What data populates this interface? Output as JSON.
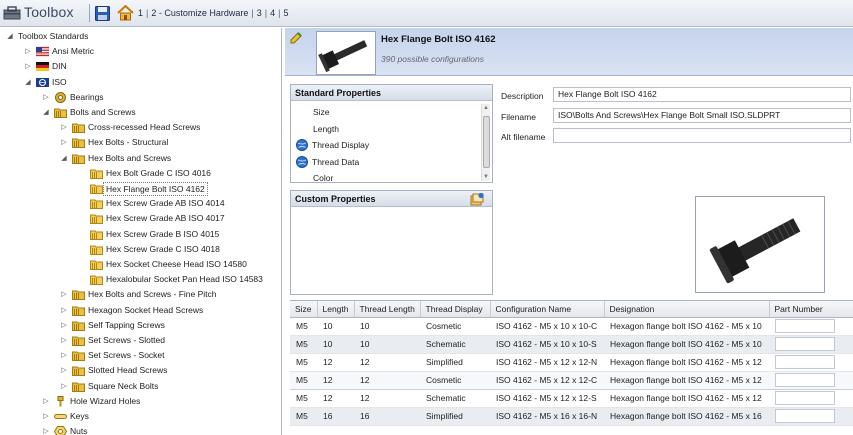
{
  "toolbar": {
    "title": "Toolbox",
    "breadcrumb": [
      "1",
      "2 - Customize Hardware",
      "3",
      "4",
      "5"
    ]
  },
  "tree": [
    {
      "label": "Toolbox Standards",
      "depth": 0,
      "twisty": "open",
      "icon": "none"
    },
    {
      "label": "Ansi Metric",
      "depth": 1,
      "twisty": "closed",
      "icon": "flag-usa-icon"
    },
    {
      "label": "DIN",
      "depth": 1,
      "twisty": "closed",
      "icon": "flag-germany-icon"
    },
    {
      "label": "ISO",
      "depth": 1,
      "twisty": "open",
      "icon": "iso-icon"
    },
    {
      "label": "Bearings",
      "depth": 2,
      "twisty": "closed",
      "icon": "bearing-icon"
    },
    {
      "label": "Bolts and Screws",
      "depth": 2,
      "twisty": "open",
      "icon": "folder-icon"
    },
    {
      "label": "Cross-recessed Head Screws",
      "depth": 3,
      "twisty": "closed",
      "icon": "folder-icon"
    },
    {
      "label": "Hex Bolts - Structural",
      "depth": 3,
      "twisty": "closed",
      "icon": "folder-icon"
    },
    {
      "label": "Hex Bolts and Screws",
      "depth": 3,
      "twisty": "open",
      "icon": "folder-icon"
    },
    {
      "label": "Hex Bolt Grade C ISO 4016",
      "depth": 4,
      "twisty": "none",
      "icon": "part-icon"
    },
    {
      "label": "Hex Flange Bolt ISO 4162",
      "depth": 4,
      "twisty": "none",
      "icon": "part-icon",
      "selected": true
    },
    {
      "label": "Hex Screw Grade AB ISO 4014",
      "depth": 4,
      "twisty": "none",
      "icon": "part-icon"
    },
    {
      "label": "Hex Screw Grade AB ISO 4017",
      "depth": 4,
      "twisty": "none",
      "icon": "part-icon"
    },
    {
      "label": "Hex Screw Grade B ISO 4015",
      "depth": 4,
      "twisty": "none",
      "icon": "part-icon"
    },
    {
      "label": "Hex Screw Grade C ISO 4018",
      "depth": 4,
      "twisty": "none",
      "icon": "part-icon"
    },
    {
      "label": "Hex Socket Cheese Head ISO 14580",
      "depth": 4,
      "twisty": "none",
      "icon": "part-icon"
    },
    {
      "label": "Hexalobular Socket Pan Head ISO 14583",
      "depth": 4,
      "twisty": "none",
      "icon": "part-icon"
    },
    {
      "label": "Hex Bolts and Screws - Fine Pitch",
      "depth": 3,
      "twisty": "closed",
      "icon": "folder-icon"
    },
    {
      "label": "Hexagon Socket Head Screws",
      "depth": 3,
      "twisty": "closed",
      "icon": "folder-icon"
    },
    {
      "label": "Self Tapping Screws",
      "depth": 3,
      "twisty": "closed",
      "icon": "folder-icon"
    },
    {
      "label": "Set Screws - Slotted",
      "depth": 3,
      "twisty": "closed",
      "icon": "folder-icon"
    },
    {
      "label": "Set Screws - Socket",
      "depth": 3,
      "twisty": "closed",
      "icon": "folder-icon"
    },
    {
      "label": "Slotted Head Screws",
      "depth": 3,
      "twisty": "closed",
      "icon": "folder-icon"
    },
    {
      "label": "Square Neck Bolts",
      "depth": 3,
      "twisty": "closed",
      "icon": "folder-icon"
    },
    {
      "label": "Hole Wizard Holes",
      "depth": 2,
      "twisty": "closed",
      "icon": "hole-icon"
    },
    {
      "label": "Keys",
      "depth": 2,
      "twisty": "closed",
      "icon": "key-icon"
    },
    {
      "label": "Nuts",
      "depth": 2,
      "twisty": "closed",
      "icon": "nut-icon"
    }
  ],
  "part": {
    "title": "Hex Flange Bolt ISO 4162",
    "configs": "390 possible configurations"
  },
  "standard_properties": {
    "heading": "Standard Properties",
    "items": [
      {
        "label": "Size",
        "icon": "none"
      },
      {
        "label": "Length",
        "icon": "none"
      },
      {
        "label": "Thread Display",
        "icon": "globe-icon"
      },
      {
        "label": "Thread Data",
        "icon": "globe-icon"
      },
      {
        "label": "Color",
        "icon": "none"
      }
    ]
  },
  "custom_properties": {
    "heading": "Custom Properties"
  },
  "fields": {
    "description_label": "Description",
    "description_value": "Hex Flange Bolt ISO 4162",
    "filename_label": "Filename",
    "filename_value": "ISO\\Bolts And Screws\\Hex Flange Bolt Small ISO.SLDPRT",
    "alt_filename_label": "Alt filename",
    "alt_filename_value": ""
  },
  "grid": {
    "columns": [
      "Size",
      "Length",
      "Thread Length",
      "Thread Display",
      "Configuration Name",
      "Designation",
      "Part Number"
    ],
    "rows": [
      [
        "M5",
        "10",
        "10",
        "Cosmetic",
        "ISO 4162 - M5 x 10 x 10-C",
        "Hexagon flange bolt ISO 4162 - M5 x 10",
        ""
      ],
      [
        "M5",
        "10",
        "10",
        "Schematic",
        "ISO 4162 - M5 x 10 x 10-S",
        "Hexagon flange bolt ISO 4162 - M5 x 10",
        ""
      ],
      [
        "M5",
        "12",
        "12",
        "Simplified",
        "ISO 4162 - M5 x 12 x 12-N",
        "Hexagon flange bolt ISO 4162 - M5 x 12",
        ""
      ],
      [
        "M5",
        "12",
        "12",
        "Cosmetic",
        "ISO 4162 - M5 x 12 x 12-C",
        "Hexagon flange bolt ISO 4162 - M5 x 12",
        ""
      ],
      [
        "M5",
        "12",
        "12",
        "Schematic",
        "ISO 4162 - M5 x 12 x 12-S",
        "Hexagon flange bolt ISO 4162 - M5 x 12",
        ""
      ],
      [
        "M5",
        "16",
        "16",
        "Simplified",
        "ISO 4162 - M5 x 16 x 16-N",
        "Hexagon flange bolt ISO 4162 - M5 x 16",
        ""
      ]
    ],
    "selected_row": 3
  }
}
